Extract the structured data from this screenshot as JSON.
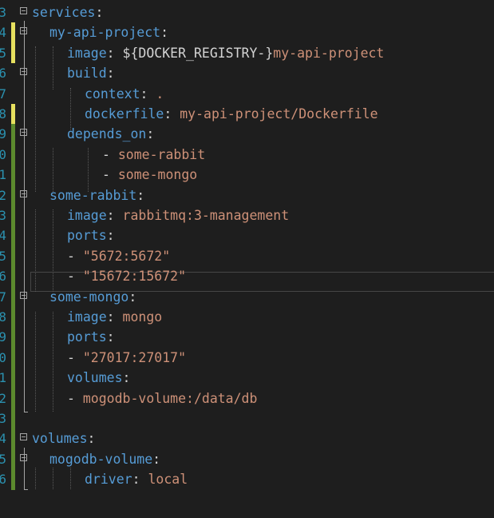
{
  "editor": {
    "lines": [
      {
        "num": "3",
        "gutter": "",
        "indent": 0,
        "parts": [
          {
            "t": "k",
            "v": "services"
          },
          {
            "t": "p",
            "v": ":"
          }
        ]
      },
      {
        "num": "4",
        "gutter": "#e6e05f",
        "indent": 1,
        "parts": [
          {
            "t": "k",
            "v": "my-api-project"
          },
          {
            "t": "p",
            "v": ":"
          }
        ]
      },
      {
        "num": "5",
        "gutter": "#e6e05f",
        "indent": 2,
        "parts": [
          {
            "t": "k",
            "v": "image"
          },
          {
            "t": "p",
            "v": ": "
          },
          {
            "t": "p",
            "v": "${DOCKER_REGISTRY-}"
          },
          {
            "t": "s",
            "v": "my-api-project"
          }
        ]
      },
      {
        "num": "6",
        "gutter": "",
        "indent": 2,
        "parts": [
          {
            "t": "k",
            "v": "build"
          },
          {
            "t": "p",
            "v": ":"
          }
        ]
      },
      {
        "num": "7",
        "gutter": "",
        "indent": 3,
        "parts": [
          {
            "t": "k",
            "v": "context"
          },
          {
            "t": "p",
            "v": ": "
          },
          {
            "t": "s",
            "v": "."
          }
        ]
      },
      {
        "num": "8",
        "gutter": "#e6e05f",
        "indent": 3,
        "parts": [
          {
            "t": "k",
            "v": "dockerfile"
          },
          {
            "t": "p",
            "v": ": "
          },
          {
            "t": "s",
            "v": "my-api-project/Dockerfile"
          }
        ]
      },
      {
        "num": "9",
        "gutter": "#5c8a2e",
        "indent": 2,
        "parts": [
          {
            "t": "k",
            "v": "depends_on"
          },
          {
            "t": "p",
            "v": ":"
          }
        ]
      },
      {
        "num": "0",
        "gutter": "#5c8a2e",
        "indent": 4,
        "parts": [
          {
            "t": "p",
            "v": "- "
          },
          {
            "t": "s",
            "v": "some-rabbit"
          }
        ]
      },
      {
        "num": "1",
        "gutter": "#5c8a2e",
        "indent": 4,
        "parts": [
          {
            "t": "p",
            "v": "- "
          },
          {
            "t": "s",
            "v": "some-mongo"
          }
        ]
      },
      {
        "num": "2",
        "gutter": "#5c8a2e",
        "indent": 1,
        "parts": [
          {
            "t": "k",
            "v": "some-rabbit"
          },
          {
            "t": "p",
            "v": ":"
          }
        ]
      },
      {
        "num": "3",
        "gutter": "#5c8a2e",
        "indent": 2,
        "parts": [
          {
            "t": "k",
            "v": "image"
          },
          {
            "t": "p",
            "v": ": "
          },
          {
            "t": "s",
            "v": "rabbitmq:3-management"
          }
        ]
      },
      {
        "num": "4",
        "gutter": "#5c8a2e",
        "indent": 2,
        "parts": [
          {
            "t": "k",
            "v": "ports"
          },
          {
            "t": "p",
            "v": ":"
          }
        ]
      },
      {
        "num": "5",
        "gutter": "#5c8a2e",
        "indent": 2,
        "parts": [
          {
            "t": "p",
            "v": "- "
          },
          {
            "t": "s",
            "v": "\"5672:5672\""
          }
        ]
      },
      {
        "num": "6",
        "gutter": "#5c8a2e",
        "indent": 2,
        "parts": [
          {
            "t": "p",
            "v": "- "
          },
          {
            "t": "s",
            "v": "\"15672:15672\""
          }
        ]
      },
      {
        "num": "7",
        "gutter": "#5c8a2e",
        "indent": 1,
        "parts": [
          {
            "t": "k",
            "v": "some-mongo"
          },
          {
            "t": "p",
            "v": ":"
          }
        ]
      },
      {
        "num": "8",
        "gutter": "#5c8a2e",
        "indent": 2,
        "parts": [
          {
            "t": "k",
            "v": "image"
          },
          {
            "t": "p",
            "v": ": "
          },
          {
            "t": "s",
            "v": "mongo"
          }
        ]
      },
      {
        "num": "9",
        "gutter": "#5c8a2e",
        "indent": 2,
        "parts": [
          {
            "t": "k",
            "v": "ports"
          },
          {
            "t": "p",
            "v": ":"
          }
        ]
      },
      {
        "num": "0",
        "gutter": "#5c8a2e",
        "indent": 2,
        "parts": [
          {
            "t": "p",
            "v": "- "
          },
          {
            "t": "s",
            "v": "\"27017:27017\""
          }
        ]
      },
      {
        "num": "1",
        "gutter": "#5c8a2e",
        "indent": 2,
        "parts": [
          {
            "t": "k",
            "v": "volumes"
          },
          {
            "t": "p",
            "v": ":"
          }
        ]
      },
      {
        "num": "2",
        "gutter": "#5c8a2e",
        "indent": 2,
        "parts": [
          {
            "t": "p",
            "v": "- "
          },
          {
            "t": "s",
            "v": "mogodb-volume:/data/db"
          }
        ]
      },
      {
        "num": "3",
        "gutter": "#5c8a2e",
        "indent": 0,
        "parts": []
      },
      {
        "num": "4",
        "gutter": "#5c8a2e",
        "indent": 0,
        "parts": [
          {
            "t": "k",
            "v": "volumes"
          },
          {
            "t": "p",
            "v": ":"
          }
        ]
      },
      {
        "num": "5",
        "gutter": "#5c8a2e",
        "indent": 1,
        "parts": [
          {
            "t": "k",
            "v": "mogodb-volume"
          },
          {
            "t": "p",
            "v": ":"
          }
        ]
      },
      {
        "num": "6",
        "gutter": "#5c8a2e",
        "indent": 3,
        "parts": [
          {
            "t": "k",
            "v": "driver"
          },
          {
            "t": "p",
            "v": ": "
          },
          {
            "t": "s",
            "v": "local"
          }
        ]
      }
    ],
    "colors": {
      "background": "#1e1e1e",
      "line_number": "#2b91af",
      "key": "#569cd6",
      "string": "#ce9178",
      "plain": "#d4d4d4",
      "modified_unsaved": "#e6e05f",
      "modified_saved": "#5c8a2e"
    }
  }
}
